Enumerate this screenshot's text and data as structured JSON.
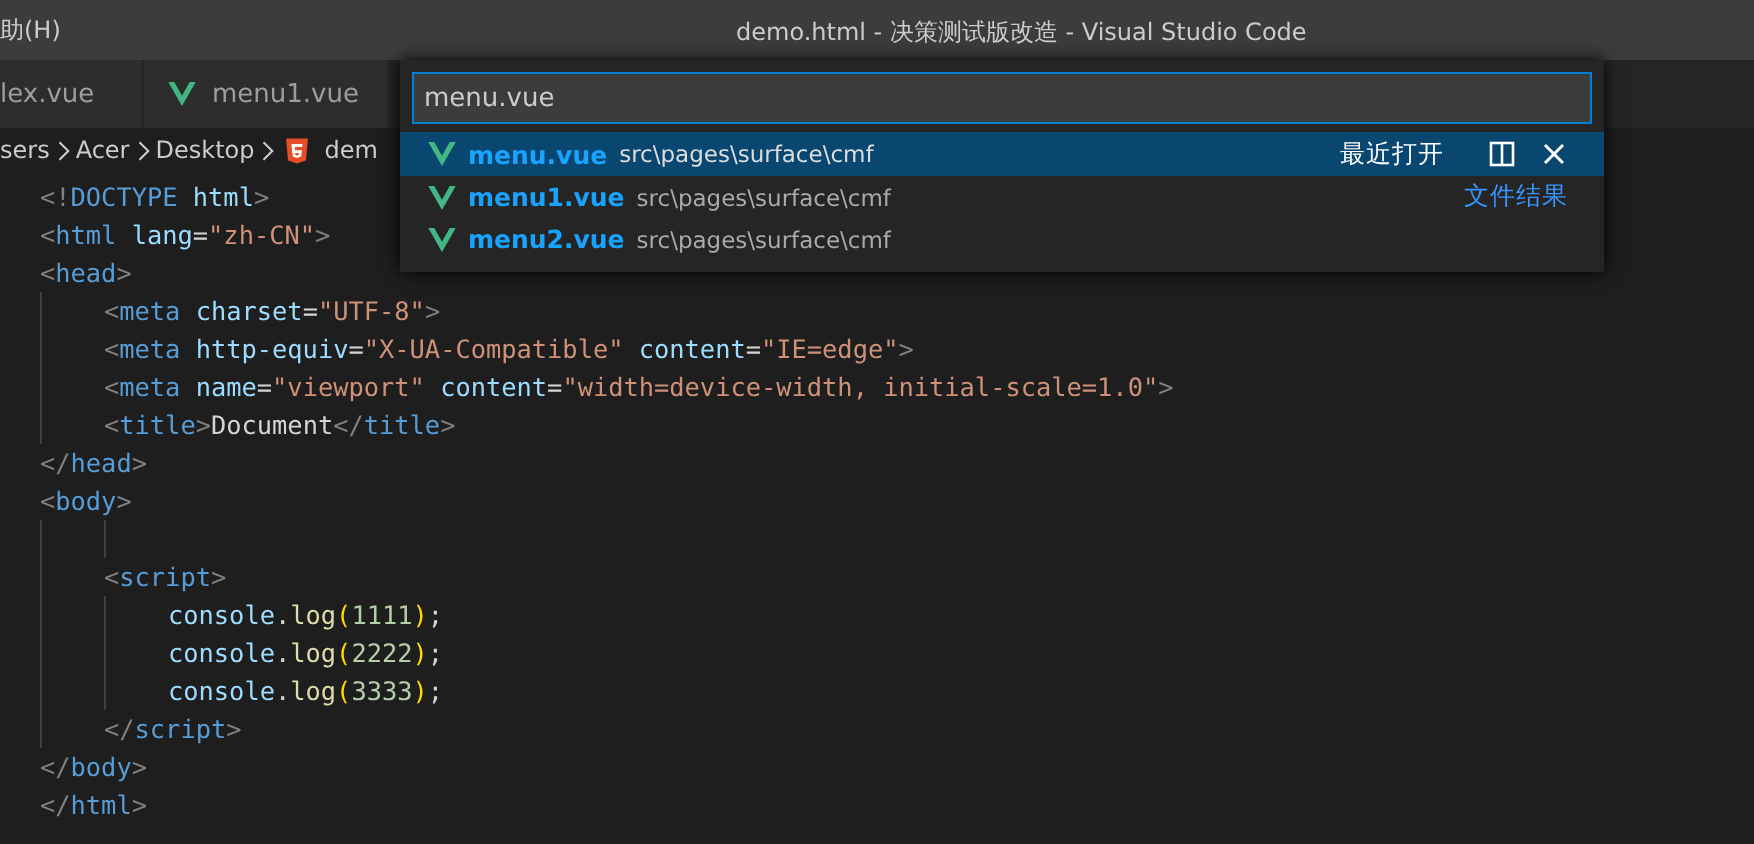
{
  "menu_bar": {
    "item": "助(H)"
  },
  "window": {
    "title": "demo.html - 决策测试版改造 - Visual Studio Code"
  },
  "tabs": [
    {
      "label": "lex.vue",
      "icon": false,
      "selected": false
    },
    {
      "label": "menu1.vue",
      "icon": true,
      "selected": false
    }
  ],
  "breadcrumb": {
    "parts": [
      "sers",
      "Acer",
      "Desktop"
    ],
    "file": "dem"
  },
  "quick_open": {
    "value": "menu.vue",
    "results": [
      {
        "name": "menu.vue",
        "path": "src\\pages\\surface\\cmf",
        "selected": true,
        "group": "最近打开"
      },
      {
        "name": "menu1.vue",
        "path": "src\\pages\\surface\\cmf",
        "selected": false,
        "group": "文件结果"
      },
      {
        "name": "menu2.vue",
        "path": "src\\pages\\surface\\cmf",
        "selected": false
      }
    ]
  },
  "code_lines": [
    {
      "tokens": [
        {
          "t": "<!",
          "kind": "p"
        },
        {
          "t": "DOCTYPE",
          "kind": "tag"
        },
        {
          "t": " html",
          "kind": "attr"
        },
        {
          "t": ">",
          "kind": "p"
        }
      ]
    },
    {
      "tokens": [
        {
          "t": "<",
          "kind": "p"
        },
        {
          "t": "html",
          "kind": "tag"
        },
        {
          "t": " lang",
          "kind": "attr"
        },
        {
          "t": "=",
          "kind": "text"
        },
        {
          "t": "\"zh-CN\"",
          "kind": "str"
        },
        {
          "t": ">",
          "kind": "p"
        }
      ]
    },
    {
      "tokens": [
        {
          "t": "<",
          "kind": "p"
        },
        {
          "t": "head",
          "kind": "tag"
        },
        {
          "t": ">",
          "kind": "p"
        }
      ],
      "children": [
        {
          "tokens": [
            {
              "t": "<",
              "kind": "p"
            },
            {
              "t": "meta",
              "kind": "tag"
            },
            {
              "t": " charset",
              "kind": "attr"
            },
            {
              "t": "=",
              "kind": "text"
            },
            {
              "t": "\"UTF-8\"",
              "kind": "str"
            },
            {
              "t": ">",
              "kind": "p"
            }
          ]
        },
        {
          "tokens": [
            {
              "t": "<",
              "kind": "p"
            },
            {
              "t": "meta",
              "kind": "tag"
            },
            {
              "t": " http-equiv",
              "kind": "attr"
            },
            {
              "t": "=",
              "kind": "text"
            },
            {
              "t": "\"X-UA-Compatible\"",
              "kind": "str"
            },
            {
              "t": " content",
              "kind": "attr"
            },
            {
              "t": "=",
              "kind": "text"
            },
            {
              "t": "\"IE=edge\"",
              "kind": "str"
            },
            {
              "t": ">",
              "kind": "p"
            }
          ]
        },
        {
          "tokens": [
            {
              "t": "<",
              "kind": "p"
            },
            {
              "t": "meta",
              "kind": "tag"
            },
            {
              "t": " name",
              "kind": "attr"
            },
            {
              "t": "=",
              "kind": "text"
            },
            {
              "t": "\"viewport\"",
              "kind": "str"
            },
            {
              "t": " content",
              "kind": "attr"
            },
            {
              "t": "=",
              "kind": "text"
            },
            {
              "t": "\"width=device-width, initial-scale=1.0\"",
              "kind": "str"
            },
            {
              "t": ">",
              "kind": "p"
            }
          ]
        },
        {
          "tokens": [
            {
              "t": "<",
              "kind": "p"
            },
            {
              "t": "title",
              "kind": "tag"
            },
            {
              "t": ">",
              "kind": "p"
            },
            {
              "t": "Document",
              "kind": "text"
            },
            {
              "t": "</",
              "kind": "p"
            },
            {
              "t": "title",
              "kind": "tag"
            },
            {
              "t": ">",
              "kind": "p"
            }
          ]
        }
      ]
    },
    {
      "tokens": [
        {
          "t": "</",
          "kind": "p"
        },
        {
          "t": "head",
          "kind": "tag"
        },
        {
          "t": ">",
          "kind": "p"
        }
      ]
    },
    {
      "tokens": [
        {
          "t": "<",
          "kind": "p"
        },
        {
          "t": "body",
          "kind": "tag"
        },
        {
          "t": ">",
          "kind": "p"
        }
      ],
      "children": [
        {
          "blank": true
        },
        {
          "tokens": [
            {
              "t": "<",
              "kind": "p"
            },
            {
              "t": "script",
              "kind": "tag"
            },
            {
              "t": ">",
              "kind": "p"
            }
          ],
          "children": [
            {
              "tokens": [
                {
                  "t": "console",
                  "kind": "attr"
                },
                {
                  "t": ".",
                  "kind": "text"
                },
                {
                  "t": "log",
                  "kind": "func"
                },
                {
                  "t": "(",
                  "kind": "paren"
                },
                {
                  "t": "1111",
                  "kind": "num"
                },
                {
                  "t": ")",
                  "kind": "paren"
                },
                {
                  "t": ";",
                  "kind": "text"
                }
              ]
            },
            {
              "tokens": [
                {
                  "t": "console",
                  "kind": "attr"
                },
                {
                  "t": ".",
                  "kind": "text"
                },
                {
                  "t": "log",
                  "kind": "func"
                },
                {
                  "t": "(",
                  "kind": "paren"
                },
                {
                  "t": "2222",
                  "kind": "num"
                },
                {
                  "t": ")",
                  "kind": "paren"
                },
                {
                  "t": ";",
                  "kind": "text"
                }
              ]
            },
            {
              "tokens": [
                {
                  "t": "console",
                  "kind": "attr"
                },
                {
                  "t": ".",
                  "kind": "text"
                },
                {
                  "t": "log",
                  "kind": "func"
                },
                {
                  "t": "(",
                  "kind": "paren"
                },
                {
                  "t": "3333",
                  "kind": "num"
                },
                {
                  "t": ")",
                  "kind": "paren"
                },
                {
                  "t": ";",
                  "kind": "text"
                }
              ]
            }
          ]
        },
        {
          "tokens": [
            {
              "t": "</",
              "kind": "p"
            },
            {
              "t": "script",
              "kind": "tag"
            },
            {
              "t": ">",
              "kind": "p"
            }
          ]
        }
      ]
    },
    {
      "tokens": [
        {
          "t": "</",
          "kind": "p"
        },
        {
          "t": "body",
          "kind": "tag"
        },
        {
          "t": ">",
          "kind": "p"
        }
      ]
    },
    {
      "tokens": [
        {
          "t": "</",
          "kind": "p"
        },
        {
          "t": "html",
          "kind": "tag"
        },
        {
          "t": ">",
          "kind": "p"
        }
      ]
    }
  ]
}
